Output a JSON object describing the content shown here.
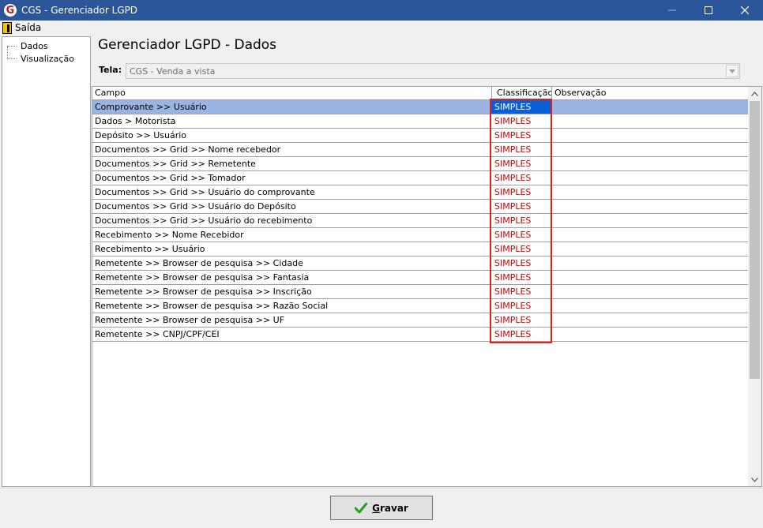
{
  "window": {
    "title": "CGS - Gerenciador LGPD",
    "icon_letter": "G",
    "controls": [
      "minimize-icon",
      "maximize-icon",
      "close-icon"
    ]
  },
  "menubar": {
    "items": [
      {
        "label": "Saída",
        "icon": "exit-door-icon"
      }
    ]
  },
  "tree": {
    "items": [
      {
        "label": "Dados"
      },
      {
        "label": "Visualização"
      }
    ]
  },
  "page": {
    "title": "Gerenciador LGPD - Dados",
    "tela_label": "Tela:",
    "tela_value": "CGS - Venda a vista"
  },
  "grid": {
    "columns": [
      "Campo",
      "Classificação",
      "Observação"
    ],
    "selected_row_index": 0,
    "rows": [
      {
        "campo": "Comprovante >> Usuário",
        "classificacao": "SIMPLES",
        "observacao": ""
      },
      {
        "campo": "Dados > Motorista",
        "classificacao": "SIMPLES",
        "observacao": ""
      },
      {
        "campo": "Depósito >> Usuário",
        "classificacao": "SIMPLES",
        "observacao": ""
      },
      {
        "campo": "Documentos >> Grid >> Nome recebedor",
        "classificacao": "SIMPLES",
        "observacao": ""
      },
      {
        "campo": "Documentos >> Grid >> Remetente",
        "classificacao": "SIMPLES",
        "observacao": ""
      },
      {
        "campo": "Documentos >> Grid >> Tomador",
        "classificacao": "SIMPLES",
        "observacao": ""
      },
      {
        "campo": "Documentos >> Grid >> Usuário do comprovante",
        "classificacao": "SIMPLES",
        "observacao": ""
      },
      {
        "campo": "Documentos >> Grid >> Usuário do Depósito",
        "classificacao": "SIMPLES",
        "observacao": ""
      },
      {
        "campo": "Documentos >> Grid >> Usuário do recebimento",
        "classificacao": "SIMPLES",
        "observacao": ""
      },
      {
        "campo": "Recebimento >> Nome Recebidor",
        "classificacao": "SIMPLES",
        "observacao": ""
      },
      {
        "campo": "Recebimento >> Usuário",
        "classificacao": "SIMPLES",
        "observacao": ""
      },
      {
        "campo": "Remetente >> Browser de pesquisa >> Cidade",
        "classificacao": "SIMPLES",
        "observacao": ""
      },
      {
        "campo": "Remetente >> Browser de pesquisa >> Fantasia",
        "classificacao": "SIMPLES",
        "observacao": ""
      },
      {
        "campo": "Remetente >> Browser de pesquisa >> Inscrição",
        "classificacao": "SIMPLES",
        "observacao": ""
      },
      {
        "campo": "Remetente >> Browser de pesquisa >> Razão Social",
        "classificacao": "SIMPLES",
        "observacao": ""
      },
      {
        "campo": "Remetente >> Browser de pesquisa >> UF",
        "classificacao": "SIMPLES",
        "observacao": ""
      },
      {
        "campo": "Remetente >> CNPJ/CPF/CEI",
        "classificacao": "SIMPLES",
        "observacao": ""
      }
    ]
  },
  "footer": {
    "save_label": "Gravar",
    "save_icon": "green-check-icon"
  },
  "colors": {
    "titlebar": "#2b579a",
    "selected_row": "#99b4e3",
    "selected_cell": "#0a5fd6",
    "classificacao_text": "#d10000",
    "highlight_box": "#e0201c",
    "check_green": "#1fa21f"
  }
}
